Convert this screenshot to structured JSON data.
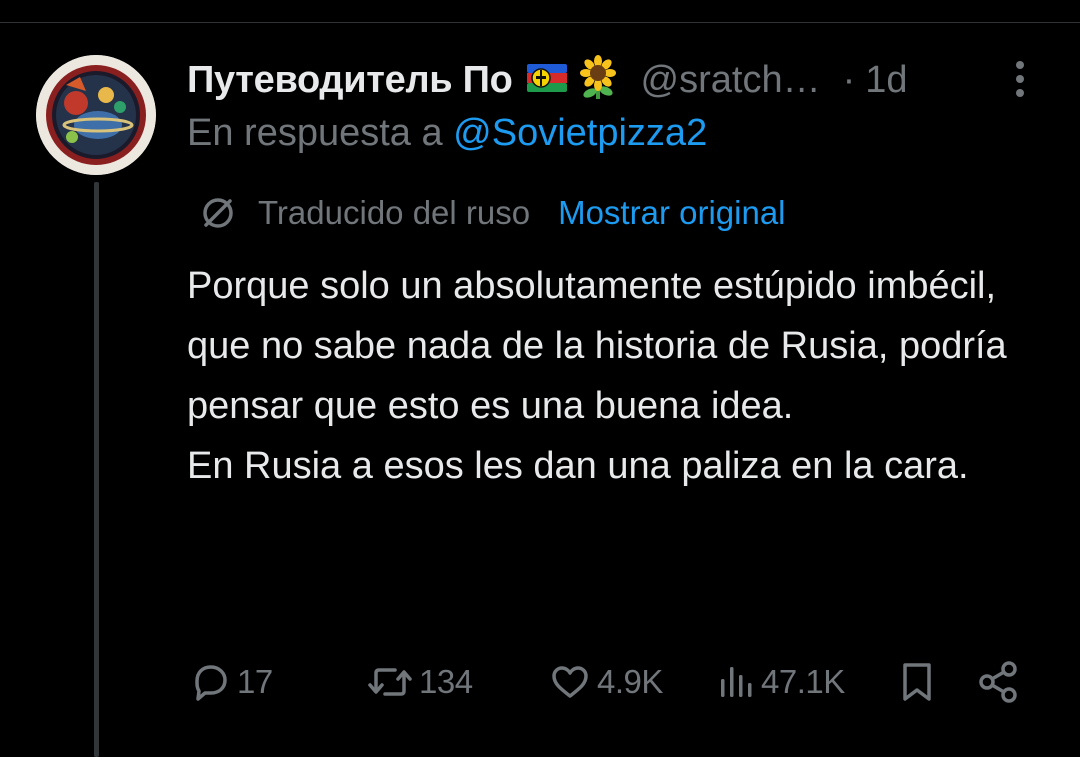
{
  "tweet": {
    "display_name": "Путеводитель По",
    "emoji_flag_icon": "new-caledonia-kanak-flag",
    "emoji_flower_icon": "sunflower-emoji",
    "handle": "@sratch…",
    "separator": "·",
    "time": "1d",
    "reply_prefix": "En respuesta a",
    "reply_mention": "@Sovietpizza2",
    "translated_label": "Traducido del ruso",
    "show_original": "Mostrar original",
    "text_paragraph_1": "Porque solo un absolutamente estúpido imbécil, que no sabe nada de la historia de Rusia, podría pensar que esto es una buena idea.",
    "text_paragraph_2": "En Rusia a esos les dan una paliza en la cara."
  },
  "actions": {
    "replies": "17",
    "reposts": "134",
    "likes": "4.9K",
    "views": "47.1K"
  },
  "colors": {
    "background": "#000000",
    "text_primary": "#e7e9ea",
    "text_secondary": "#71767b",
    "accent": "#1d9bf0"
  }
}
